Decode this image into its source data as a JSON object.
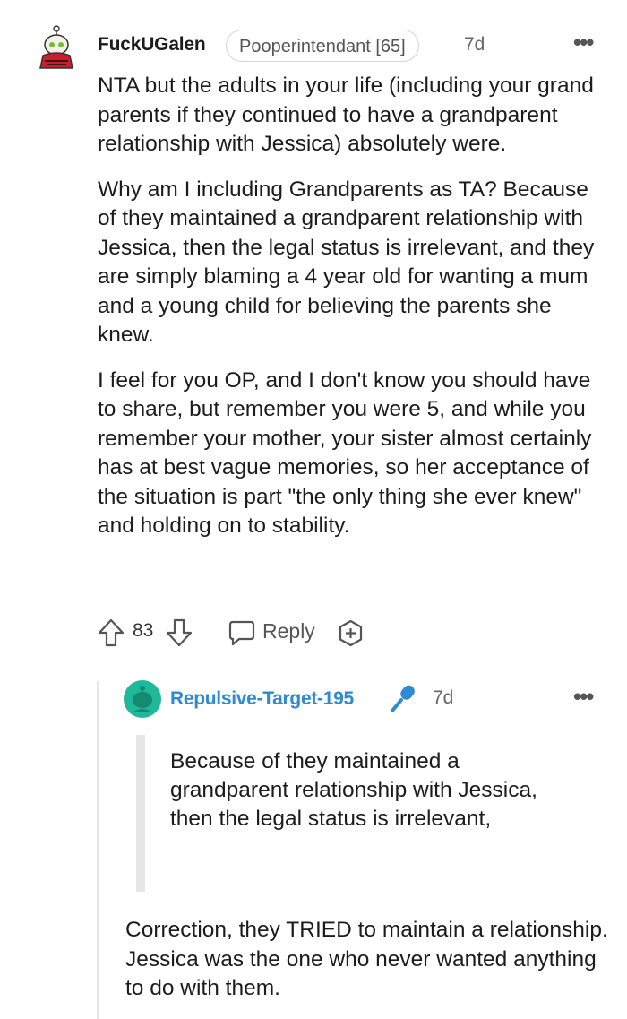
{
  "comment": {
    "username": "FuckUGalen",
    "flair": "Pooperintendant [65]",
    "time": "7d",
    "more": "•••",
    "paragraphs": [
      "NTA but the adults in your life (including your grand parents if they continued to have a grandparent relationship with Jessica) absolutely were.",
      "Why am I including Grandparents as TA? Because of they maintained a grandparent relationship with Jessica, then the legal status is irrelevant, and they are simply blaming a 4 year old for wanting a mum and a young child for believing the parents she knew.",
      "I feel for you OP, and I don't know you should have to share, but remember you were 5, and while you remember your mother, your sister almost certainly has at best vague memories, so her acceptance of the situation is part \"the only thing she ever knew\" and holding on to stability."
    ],
    "score": "83",
    "reply_label": "Reply"
  },
  "reply": {
    "username": "Repulsive-Target-195",
    "time": "7d",
    "more": "•••",
    "quote": "Because of they maintained a grandparent relationship with Jessica, then the legal status is irrelevant,",
    "text": "Correction, they TRIED to maintain a relationship. Jessica was the one who never wanted anything to do with them."
  },
  "colors": {
    "reply_username": "#2d8bd3",
    "mic": "#2d8bd3",
    "reply_avatar": "#1fb89a"
  }
}
